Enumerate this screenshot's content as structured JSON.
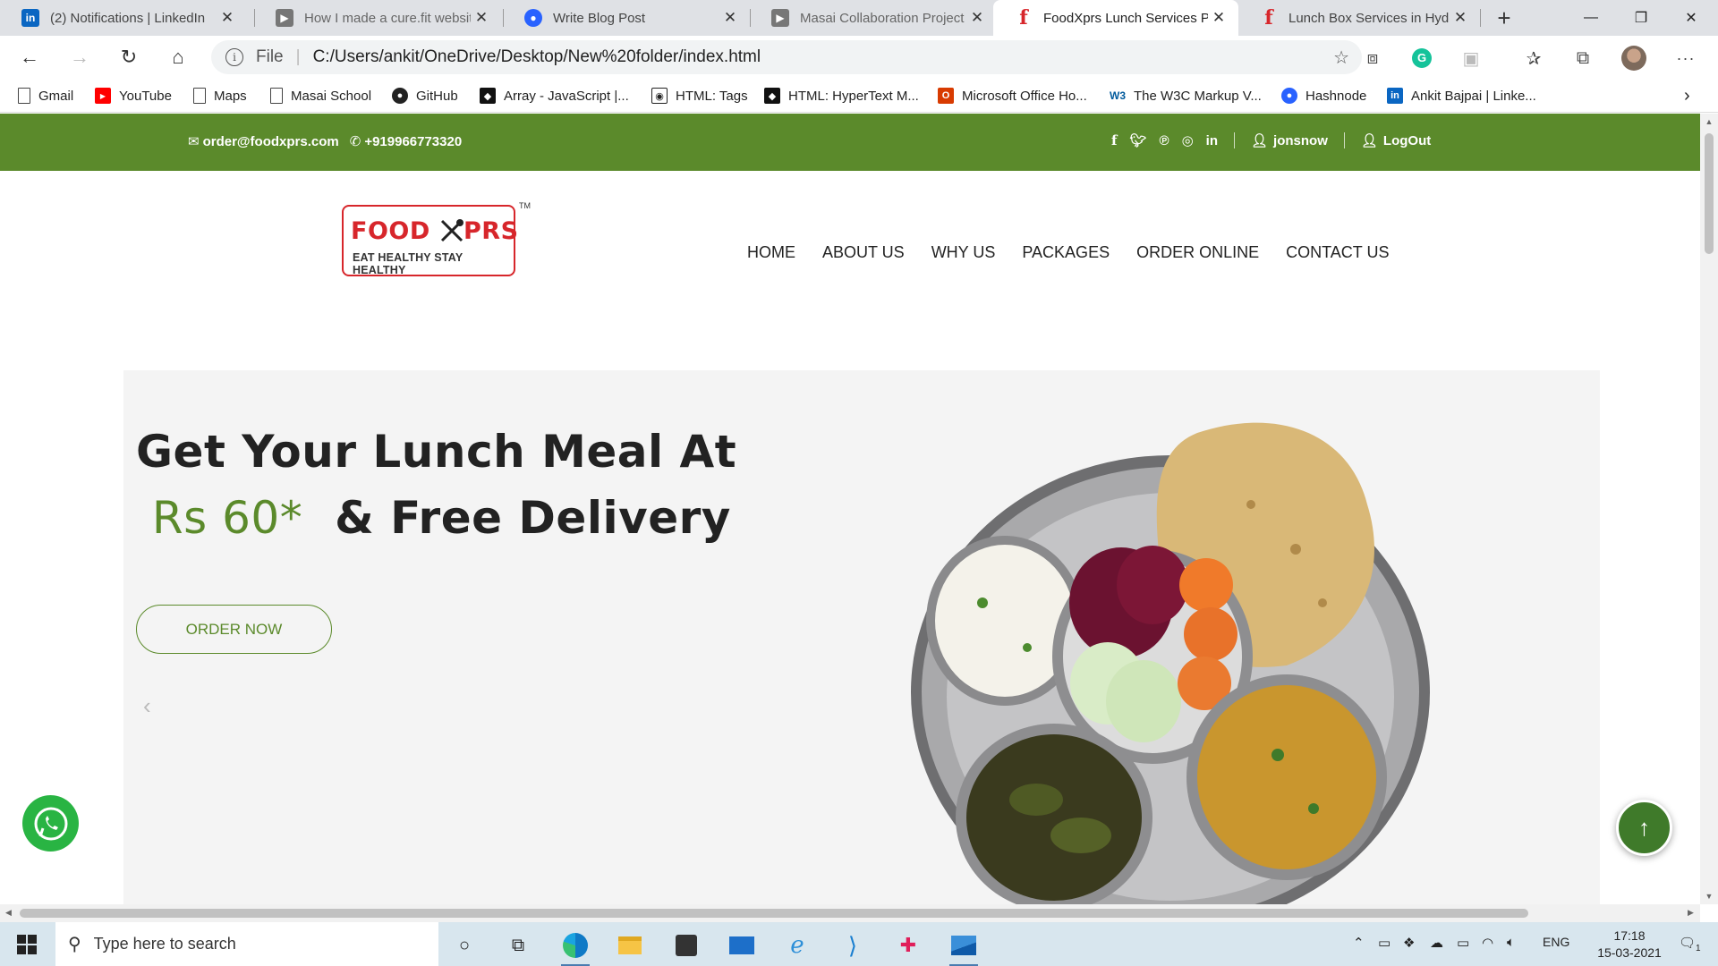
{
  "browser": {
    "tabs": [
      {
        "label": "(2) Notifications | LinkedIn",
        "icon": "linkedin-icon",
        "color": "#0a66c2"
      },
      {
        "label": "How I made a cure.fit website",
        "icon": "video-icon",
        "color": "#666666"
      },
      {
        "label": "Write Blog Post",
        "icon": "hashnode-icon",
        "color": "#2962ff"
      },
      {
        "label": "Masai Collaboration Project -",
        "icon": "video-icon",
        "color": "#666666"
      },
      {
        "label": "FoodXprs Lunch Services Pvt",
        "icon": "foodxprs-icon",
        "color": "#d7262b"
      },
      {
        "label": "Lunch Box Services in Hydera",
        "icon": "foodxprs-icon",
        "color": "#d7262b"
      }
    ],
    "active_tab": 4,
    "address": {
      "protocol_label": "File",
      "url": "C:/Users/ankit/OneDrive/Desktop/New%20folder/index.html"
    },
    "bookmarks": [
      {
        "label": "Gmail",
        "icon": "page-icon"
      },
      {
        "label": "YouTube",
        "icon": "youtube-icon"
      },
      {
        "label": "Maps",
        "icon": "page-icon"
      },
      {
        "label": "Masai School",
        "icon": "page-icon"
      },
      {
        "label": "GitHub",
        "icon": "github-icon"
      },
      {
        "label": "Array - JavaScript |...",
        "icon": "mdn-icon"
      },
      {
        "label": "HTML: Tags",
        "icon": "tags-icon"
      },
      {
        "label": "HTML: HyperText M...",
        "icon": "mdn-icon"
      },
      {
        "label": "Microsoft Office Ho...",
        "icon": "office-icon"
      },
      {
        "label": "The W3C Markup V...",
        "icon": "w3c-icon"
      },
      {
        "label": "Hashnode",
        "icon": "hashnode-icon"
      },
      {
        "label": "Ankit Bajpai | Linke...",
        "icon": "linkedin-icon"
      }
    ]
  },
  "site": {
    "topbar": {
      "email": "order@foodxprs.com",
      "phone": "+919966773320",
      "username": "jonsnow",
      "logout": "LogOut",
      "color": "#5b8a2b"
    },
    "logo": {
      "brand_left": "FOOD",
      "brand_right": "PRS",
      "tagline": "EAT HEALTHY STAY HEALTHY",
      "tm": "TM"
    },
    "nav": [
      "HOME",
      "ABOUT US",
      "WHY US",
      "PACKAGES",
      "ORDER ONLINE",
      "CONTACT US"
    ],
    "hero": {
      "headline_line1": "Get Your Lunch Meal At",
      "price": "Rs 60*",
      "headline_rest": "& Free Delivery",
      "cta": "ORDER NOW",
      "prev_arrow": "‹"
    }
  },
  "taskbar": {
    "search_placeholder": "Type here to search",
    "language": "ENG",
    "time": "17:18",
    "date": "15-03-2021",
    "notification_count": "1"
  }
}
